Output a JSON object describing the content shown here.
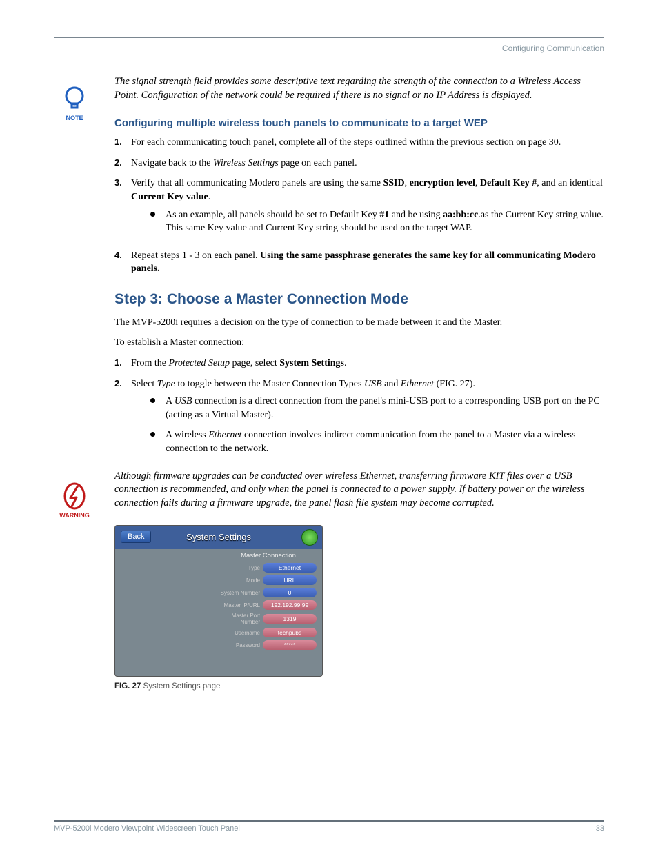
{
  "header": {
    "section": "Configuring Communication"
  },
  "note": {
    "label": "NOTE",
    "text": "The signal strength field provides some descriptive text regarding the strength of the connection to a Wireless Access Point. Configuration of the network could be required if there is no signal or no IP Address is displayed."
  },
  "sectionA": {
    "title": "Configuring multiple wireless touch panels to communicate to a target WEP",
    "items": {
      "n1": "1.",
      "t1a": "For each communicating touch panel, complete all of the steps outlined within the previous  section on page 30.",
      "n2": "2.",
      "t2a": "Navigate back to the ",
      "t2b": "Wireless Settings",
      "t2c": " page on each panel.",
      "n3": "3.",
      "t3a": "Verify that all communicating Modero panels are using the same ",
      "t3b": "SSID",
      "t3c": ", ",
      "t3d": "encryption level",
      "t3e": ", ",
      "t3f": "Default Key #",
      "t3g": ", and an identical ",
      "t3h": "Current Key value",
      "t3i": ".",
      "b1a": "As an example, all panels should be set to Default Key ",
      "b1b": "#1",
      "b1c": " and be using ",
      "b1d": "aa:bb:cc",
      "b1e": ".as the Current Key string value. This same Key value and Current Key string should be used on the target WAP.",
      "n4": "4.",
      "t4a": "Repeat steps 1 - 3 on each panel. ",
      "t4b": "Using the same passphrase generates the same key for all communicating Modero panels."
    }
  },
  "step3": {
    "title": "Step 3: Choose a Master Connection Mode",
    "p1": "The MVP-5200i requires a decision on the type of connection to be made between it and the Master.",
    "p2": "To establish a Master connection:",
    "items": {
      "n1": "1.",
      "t1a": "From the ",
      "t1b": "Protected Setup",
      "t1c": " page, select ",
      "t1d": "System Settings",
      "t1e": ".",
      "n2": "2.",
      "t2a": "Select ",
      "t2b": "Type",
      "t2c": " to toggle between the Master Connection Types ",
      "t2d": "USB",
      "t2e": " and ",
      "t2f": "Ethernet",
      "t2g": " (FIG. 27).",
      "b1a": "A ",
      "b1b": "USB",
      "b1c": " connection is a direct connection from the panel's mini-USB port to a corresponding USB port on the PC (acting as a Virtual Master).",
      "b2a": "A wireless ",
      "b2b": "Ethernet",
      "b2c": " connection involves indirect communication from the panel to a Master via a wireless connection to the network."
    }
  },
  "warning": {
    "label": "WARNING",
    "text": "Although firmware upgrades can be conducted over wireless Ethernet, transferring firmware KIT files over a USB connection is recommended, and only when the panel is connected to a power supply. If battery power or the wireless connection fails during a firmware upgrade, the panel flash file system may become corrupted."
  },
  "screenshot": {
    "back": "Back",
    "title": "System Settings",
    "section_header": "Master Connection",
    "rows": [
      {
        "label": "Type",
        "value": "Ethernet",
        "style": "blue"
      },
      {
        "label": "Mode",
        "value": "URL",
        "style": "blue"
      },
      {
        "label": "System Number",
        "value": "0",
        "style": "blue"
      },
      {
        "label": "Master IP/URL",
        "value": "192.192.99.99",
        "style": "pink"
      },
      {
        "label": "Master Port Number",
        "value": "1319",
        "style": "pink"
      },
      {
        "label": "Username",
        "value": "techpubs",
        "style": "pink"
      },
      {
        "label": "Password",
        "value": "*****",
        "style": "pink"
      }
    ]
  },
  "figcaption": {
    "bold": "FIG. 27",
    "rest": "  System Settings page"
  },
  "footer": {
    "left": "MVP-5200i Modero Viewpoint Widescreen Touch Panel",
    "right": "33"
  }
}
